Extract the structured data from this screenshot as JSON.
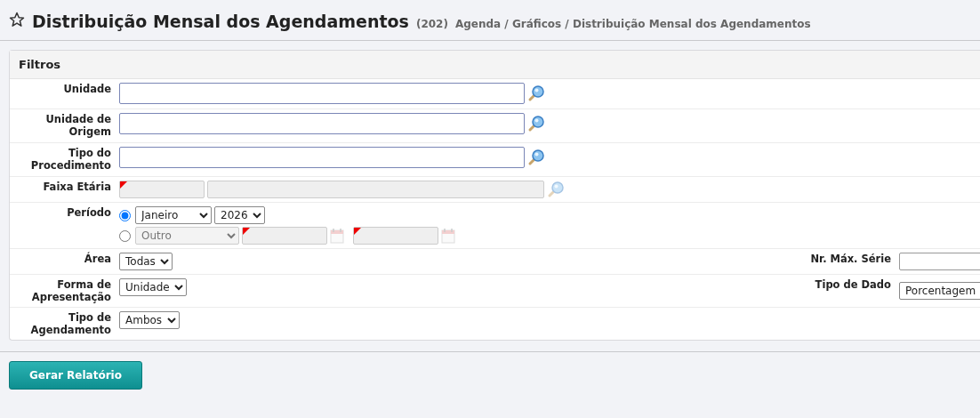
{
  "header": {
    "title": "Distribuição Mensal dos Agendamentos",
    "count": "(202)",
    "breadcrumb": "Agenda / Gráficos / Distribuição Mensal dos Agendamentos"
  },
  "filters": {
    "title": "Filtros",
    "rows": [
      {
        "kind": "lookup",
        "label": "Unidade",
        "disabled": false
      },
      {
        "kind": "lookup",
        "label": "Unidade de Origem",
        "disabled": false
      },
      {
        "kind": "lookup",
        "label": "Tipo do Procedimento",
        "disabled": false
      },
      {
        "kind": "range_lookup",
        "label": "Faixa Etária",
        "disabled": true
      },
      {
        "kind": "period",
        "label": "Período",
        "options": [
          {
            "kind": "month_year",
            "selected": true,
            "month": "Janeiro",
            "year": "2026"
          },
          {
            "kind": "custom",
            "selected": false,
            "value": "Outro"
          }
        ]
      },
      {
        "kind": "pair",
        "label": "Área",
        "value": "Todas",
        "right": {
          "kind": "text",
          "label": "Nr. Máx. Série"
        }
      },
      {
        "kind": "pair",
        "label": "Forma de Apresentação",
        "value": "Unidade",
        "right": {
          "kind": "select",
          "label": "Tipo de Dado",
          "value": "Porcentagem"
        }
      },
      {
        "kind": "pair",
        "label": "Tipo de Agendamento",
        "value": "Ambos"
      }
    ]
  },
  "submit": {
    "label": "Gerar Relatório"
  }
}
